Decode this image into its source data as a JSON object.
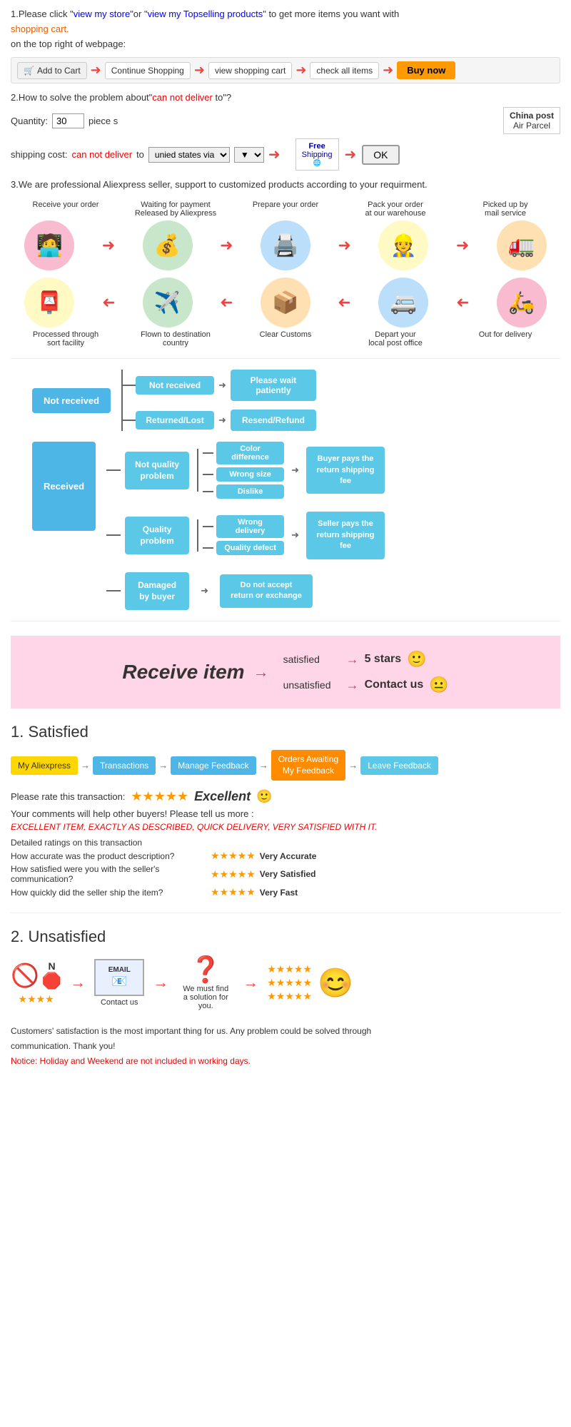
{
  "section1": {
    "text1": "1.Please click ",
    "link1": "view my store",
    "text2": "or ",
    "link2": "view my Topselling products",
    "text3": " to get more items you want with",
    "shopping_cart": "shopping cart.",
    "text4": "on the top right of webpage:",
    "steps": [
      {
        "label": "Add to Cart",
        "icon": "🛒"
      },
      {
        "label": "Continue Shopping"
      },
      {
        "label": "view shopping cart"
      },
      {
        "label": "check all items"
      },
      {
        "label": "Buy now",
        "type": "button"
      }
    ]
  },
  "section2": {
    "title": "2.How to solve the problem about",
    "red_text": "can not deliver",
    "title2": " to\"?",
    "qty_label": "Quantity:",
    "qty_value": "30",
    "qty_unit": "piece s",
    "ship_label": "shipping cost:",
    "ship_red": "can not deliver",
    "ship_to": " to ",
    "ship_via": "unied states via",
    "china_post": "China post",
    "air_parcel": "Air Parcel",
    "free_shipping": "Free Shipping",
    "ok_label": "OK"
  },
  "section3": {
    "text": "3.We are professional Aliexpress seller, support to customized products according to your requirment."
  },
  "process_flow": {
    "row1": [
      {
        "label": "Receive your order",
        "icon": "🧑‍💻",
        "color": "pink"
      },
      {
        "label": "Waiting for payment\nReleased by Aliexpress",
        "icon": "💰",
        "color": "green"
      },
      {
        "label": "Prepare your order",
        "icon": "🖨️",
        "color": "blue"
      },
      {
        "label": "Pack your order\nat our warehouse",
        "icon": "👷",
        "color": "yellow"
      },
      {
        "label": "Picked up by\nmail service",
        "icon": "🚛",
        "color": "orange"
      }
    ],
    "row2": [
      {
        "label": "Out for delivery",
        "icon": "🛵",
        "color": "pink"
      },
      {
        "label": "Depart your\nlocal post office",
        "icon": "🚐",
        "color": "blue"
      },
      {
        "label": "Clear Customs",
        "icon": "📦",
        "color": "orange"
      },
      {
        "label": "Flown to destination\ncountry",
        "icon": "✈️",
        "color": "green"
      },
      {
        "label": "Processed through\nsort facility",
        "icon": "📮",
        "color": "yellow"
      }
    ]
  },
  "not_received": {
    "main": "Not received",
    "branches": [
      {
        "label": "Not received",
        "result": "Please wait\npatiently"
      },
      {
        "label": "Returned/Lost",
        "result": "Resend/Refund"
      }
    ]
  },
  "received": {
    "main": "Received",
    "branches": [
      {
        "label": "Not quality\nproblem",
        "sub_items": [
          "Color difference",
          "Wrong size",
          "Dislike"
        ],
        "outcome": "Buyer pays the\nreturn shipping fee"
      },
      {
        "label": "Quality\nproblem",
        "sub_items": [
          "Wrong delivery",
          "Quality defect"
        ],
        "outcome": "Seller pays the\nreturn shipping fee"
      },
      {
        "label": "Damaged\nby buyer",
        "single_result": "Do not accept\nreturn or exchange"
      }
    ]
  },
  "receive_item": {
    "title": "Receive item",
    "outcomes": [
      {
        "label": "satisfied",
        "arrow": "→",
        "result": "5 stars",
        "icon": "🙂"
      },
      {
        "label": "unsatisfied",
        "arrow": "→",
        "result": "Contact us",
        "icon": "😐"
      }
    ]
  },
  "satisfied": {
    "title": "1. Satisfied",
    "breadcrumb": [
      {
        "label": "My Aliexpress",
        "type": "yellow"
      },
      {
        "label": "Transactions",
        "type": "blue"
      },
      {
        "label": "Manage Feedback",
        "type": "blue"
      },
      {
        "label": "Orders Awaiting\nMy Feedback",
        "type": "orange"
      },
      {
        "label": "Leave Feedback",
        "type": "green"
      }
    ],
    "rate_text": "Please rate this transaction:",
    "stars": "★★★★★",
    "excellent": "Excellent",
    "excellent_icon": "🙂",
    "comments_text": "Your comments will help other buyers! Please tell us more :",
    "example_comment": "EXCELLENT ITEM, EXACTLY AS DESCRIBED, QUICK DELIVERY, VERY SATISFIED WITH IT.",
    "detailed_label": "Detailed ratings on this transaction",
    "ratings": [
      {
        "label": "How accurate was the product description?",
        "stars": "★★★★★",
        "result": "Very Accurate"
      },
      {
        "label": "How satisfied were you with the seller's communication?",
        "stars": "★★★★★",
        "result": "Very Satisfied"
      },
      {
        "label": "How quickly did the seller ship the item?",
        "stars": "★★★★★",
        "result": "Very Fast"
      }
    ]
  },
  "unsatisfied": {
    "title": "2. Unsatisfied",
    "steps": [
      {
        "icon": "🚫",
        "sub": "★★★★"
      },
      {
        "icon": "🛑",
        "sub": "N"
      },
      {
        "label": "EMAIL",
        "icon": "📧"
      },
      {
        "icon": "❓"
      },
      {
        "icon": "😊",
        "sub": "★★★★★\n★★★★★\n★★★★★"
      }
    ],
    "contact_label": "Contact us",
    "find_solution": "We must find\na solution for\nyou."
  },
  "notice": {
    "text1": "Customers' satisfaction is the most important thing for us. Any problem could be solved through",
    "text2": "communication. Thank you!",
    "notice_text": "Notice: Holiday and Weekend are not included in working days."
  }
}
